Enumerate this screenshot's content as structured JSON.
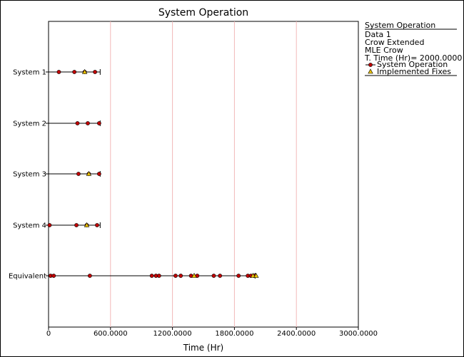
{
  "chart_data": {
    "type": "scatter",
    "title": "System Operation",
    "xlabel": "Time (Hr)",
    "ylabel": "",
    "xlim": [
      0,
      3000
    ],
    "x_ticks": [
      0,
      600,
      1200,
      1800,
      2400,
      3000
    ],
    "x_tick_labels": [
      "0",
      "600.0000",
      "1200.0000",
      "1800.0000",
      "2400.0000",
      "3000.0000"
    ],
    "gridlines_x": [
      600,
      1200,
      1800,
      2400
    ],
    "grid": "vertical",
    "legend_position": "right",
    "categories": [
      "System 1",
      "System 2",
      "System 3",
      "System 4",
      "Equivalent"
    ],
    "systems": [
      {
        "name": "System 1",
        "end_time": 500,
        "failures": [
          100,
          250,
          350,
          450
        ],
        "fixes": [
          350
        ]
      },
      {
        "name": "System 2",
        "end_time": 500,
        "failures": [
          280,
          380,
          490
        ],
        "fixes": []
      },
      {
        "name": "System 3",
        "end_time": 500,
        "failures": [
          290,
          390,
          490
        ],
        "fixes": [
          390
        ]
      },
      {
        "name": "System 4",
        "end_time": 500,
        "failures": [
          10,
          270,
          370,
          470
        ],
        "fixes": [
          370
        ]
      },
      {
        "name": "Equivalent",
        "end_time": 2000,
        "failures": [
          20,
          50,
          400,
          1000,
          1040,
          1070,
          1230,
          1280,
          1380,
          1440,
          1600,
          1660,
          1840,
          1930,
          1960,
          1990
        ],
        "fixes": [
          1410,
          1980,
          2010
        ]
      }
    ],
    "legend": {
      "header": "System Operation",
      "lines": [
        "Data 1",
        "Crow Extended",
        "MLE Crow",
        "T. Time (Hr)= 2000.0000"
      ],
      "series": [
        {
          "name": "System Operation",
          "marker": "circle",
          "color": "#c00000"
        },
        {
          "name": "Implemented Fixes",
          "marker": "triangle",
          "color": "#e8c000"
        }
      ]
    }
  }
}
